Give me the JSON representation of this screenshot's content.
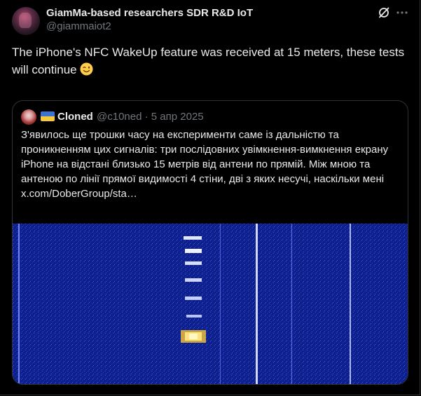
{
  "author": {
    "display_name": "GiamMa-based researchers SDR R&D IoT",
    "handle": "@giammaiot2",
    "avatar_icon": "avatar-image"
  },
  "tweet": {
    "text": "The iPhone's NFC WakeUp feature was received at 15 meters, these tests will continue",
    "emoji": "winking-face-icon"
  },
  "actions": {
    "grok_icon": "grok-icon",
    "more_icon": "more-options-icon"
  },
  "quoted": {
    "display_name": "Cloned",
    "handle": "@c10ned",
    "separator": "·",
    "date": "5 апр 2025",
    "flag_icon": "ukraine-flag-icon",
    "text": "З'явилось ще трошки часу на експерименти саме із дальністю та проникненням цих сигналів: три послідовних увімкнення-вимкнення екрану iPhone на відстані близько 15 метрів від антени по прямій. Між мною та антеною по лінії прямої видимості 4 стіни, дві з яких несучі, наскільки мені x.com/DoberGroup/sta…",
    "media": "waterfall-spectrogram-image"
  },
  "colors": {
    "background": "#000000",
    "text": "#e7e9ea",
    "muted": "#71767b",
    "border": "#2f3336",
    "spectrogram_bg": "#0c1f8a"
  }
}
